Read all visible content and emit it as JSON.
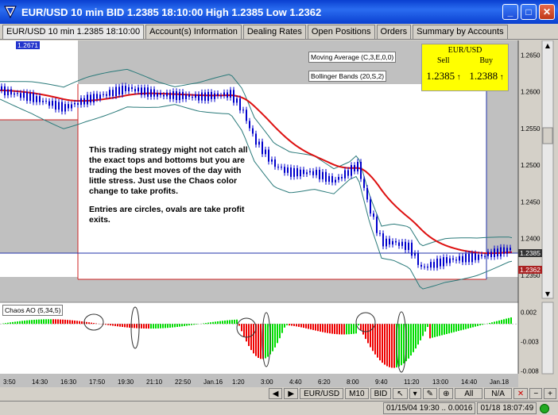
{
  "window": {
    "title": "EUR/USD 10 min BID 1.2385 18:10:00 High 1.2385 Low 1.2362",
    "buttons": [
      "minimize",
      "maximize",
      "close"
    ]
  },
  "tabs": [
    {
      "label": "EUR/USD 10 min 1.2385 18:10:00",
      "active": true
    },
    {
      "label": "Account(s) Information",
      "active": false
    },
    {
      "label": "Dealing Rates",
      "active": false
    },
    {
      "label": "Open Positions",
      "active": false
    },
    {
      "label": "Orders",
      "active": false
    },
    {
      "label": "Summary by Accounts",
      "active": false
    }
  ],
  "chart": {
    "top_left_marker": "1.2671",
    "indicators": {
      "ma_label": "Moving Average (C,3,E,0,0)",
      "bb_label": "Bollinger Bands (20,S,2)",
      "ao_label": "Chaos AO (5,34,5)"
    },
    "rate_box": {
      "title": "EUR/USD",
      "sell_label": "Sell",
      "buy_label": "Buy",
      "sell_value": "1.2385",
      "buy_value": "1.2388",
      "arrow": "↑"
    },
    "note": {
      "para1": "This trading strategy might not catch all the exact tops and bottoms but you are trading the best moves of the day with little stress.  Just use the Chaos color change to take profits.",
      "para2": "Entries are circles, ovals are take profit exits."
    },
    "price_axis": [
      "1.2650",
      "1.2600",
      "1.2550",
      "1.2500",
      "1.2450",
      "1.2400",
      "1.2350"
    ],
    "price_tags": {
      "current": "1.2385",
      "low": "1.2362"
    },
    "ao_axis": [
      "0.002",
      "-0.003",
      "-0.008"
    ],
    "time_axis": [
      "3:50",
      "14:30",
      "16:30",
      "17:50",
      "19:30",
      "21:10",
      "22:50",
      "Jan.16",
      "1:20",
      "3:00",
      "4:40",
      "6:20",
      "8:00",
      "9:40",
      "11:20",
      "13:00",
      "14:40",
      "Jan.18"
    ]
  },
  "chart_data": {
    "type": "candlestick",
    "instrument": "EUR/USD",
    "timeframe": "10 min",
    "price_ylim": [
      1.234,
      1.267
    ],
    "ao_ylim": [
      -0.0085,
      0.003
    ]
  },
  "bottom_buttons": [
    "EUR/USD",
    "M10",
    "BID",
    "All",
    "N/A"
  ],
  "status": {
    "range": "01/15/04 19:30 .. 0.0016",
    "time": "01/18 18:07:49"
  },
  "colors": {
    "titlebar": "#0a3fd0",
    "chart_bg": "#ffffff",
    "candles": "#0000cc",
    "ma_line": "#dd1010",
    "bb_line": "#2a7a7a",
    "ao_up": "#00dd00",
    "ao_down": "#ee0000",
    "rate_box": "#ffff00"
  }
}
